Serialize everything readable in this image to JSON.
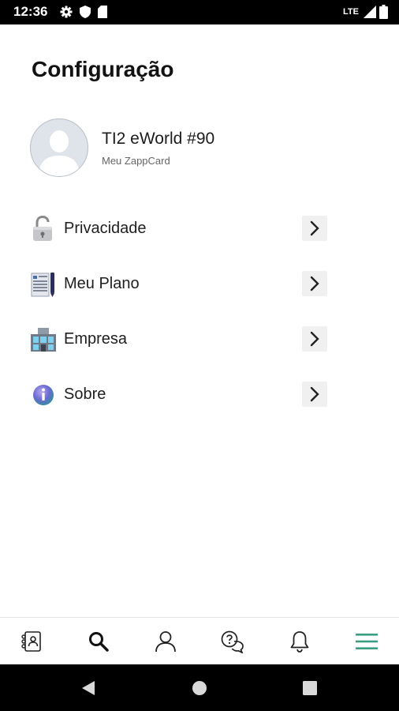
{
  "status_bar": {
    "time": "12:36",
    "network": "LTE"
  },
  "page": {
    "title": "Configuração"
  },
  "profile": {
    "name": "TI2 eWorld #90",
    "subtitle": "Meu ZappCard"
  },
  "menu": [
    {
      "label": "Privacidade",
      "icon": "lock-icon"
    },
    {
      "label": "Meu Plano",
      "icon": "plan-document-icon"
    },
    {
      "label": "Empresa",
      "icon": "company-building-icon"
    },
    {
      "label": "Sobre",
      "icon": "info-icon"
    }
  ],
  "bottom_nav": [
    {
      "name": "contacts",
      "icon": "contacts-icon",
      "active": false
    },
    {
      "name": "search",
      "icon": "search-icon",
      "active": false
    },
    {
      "name": "profile",
      "icon": "person-icon",
      "active": false
    },
    {
      "name": "help-chat",
      "icon": "help-chat-icon",
      "active": false
    },
    {
      "name": "notifications",
      "icon": "bell-icon",
      "active": false
    },
    {
      "name": "menu",
      "icon": "menu-icon",
      "active": true
    }
  ],
  "colors": {
    "accent": "#3a9d7f",
    "text": "#1f1f1f",
    "status_bar": "#000000"
  }
}
